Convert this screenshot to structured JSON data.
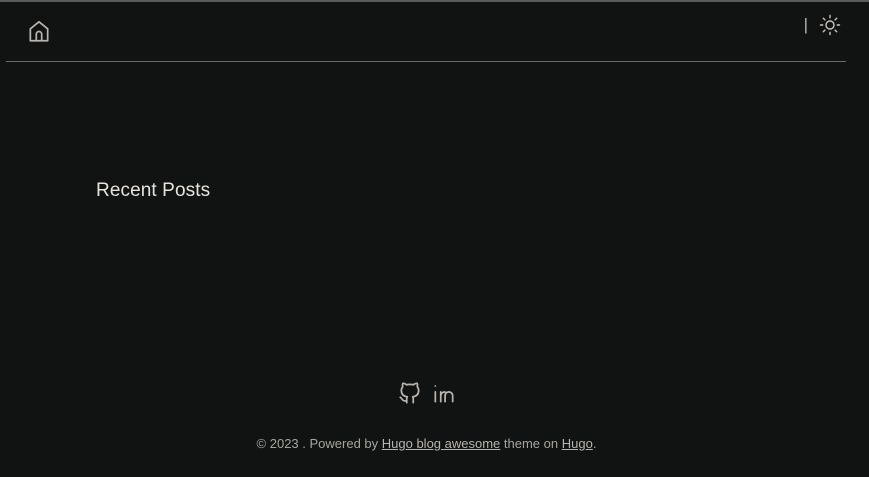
{
  "header": {
    "home_icon": "home-icon",
    "separator": "|",
    "theme_toggle_icon": "sun-icon"
  },
  "main": {
    "section_title": "Recent Posts"
  },
  "footer": {
    "social": [
      {
        "icon": "github-icon"
      },
      {
        "icon": "linkedin-icon"
      }
    ],
    "copyright_prefix": "© 2023 . Powered by ",
    "theme_link": "Hugo blog awesome",
    "middle_text": " theme on ",
    "hugo_link": "Hugo",
    "suffix": "."
  },
  "colors": {
    "background": "#111313",
    "text_primary": "#e6e3dd",
    "text_muted": "#a7a39c",
    "divider": "#6a6863"
  }
}
